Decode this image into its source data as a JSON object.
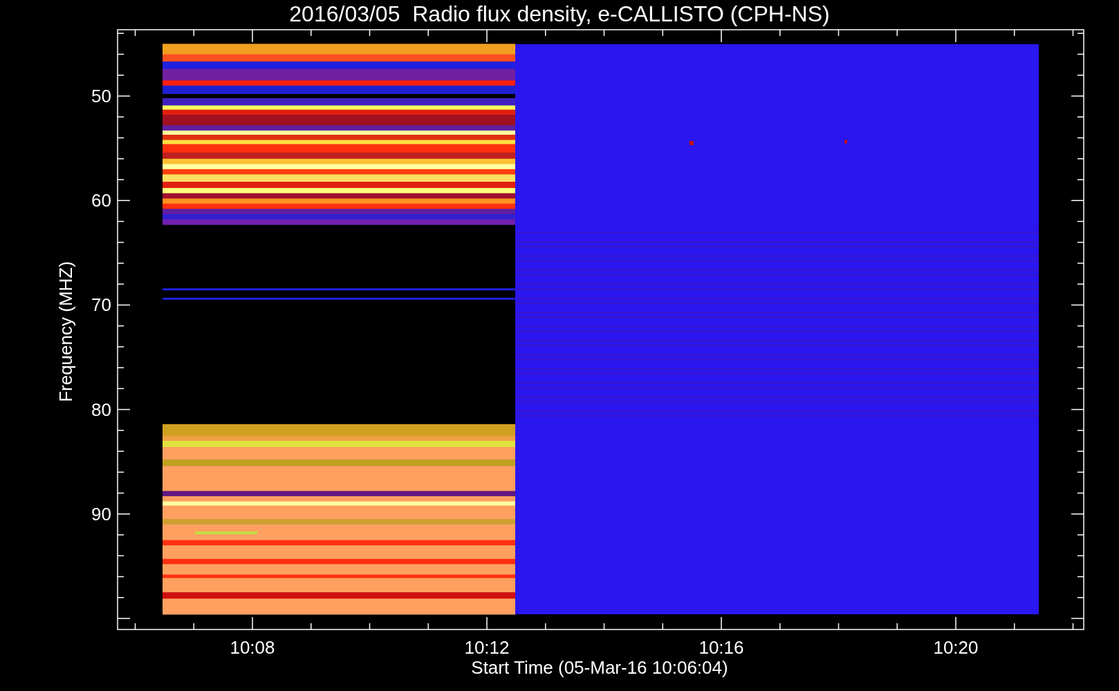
{
  "title": "2016/03/05  Radio flux density, e-CALLISTO (CPH-NS)",
  "y_axis": {
    "label": "Frequency (MHZ)",
    "ticks": [
      "50",
      "60",
      "70",
      "80",
      "90"
    ]
  },
  "x_axis": {
    "label": "Start Time (05-Mar-16 10:06:04)",
    "ticks": [
      "10:08",
      "10:12",
      "10:16",
      "10:20"
    ]
  }
}
